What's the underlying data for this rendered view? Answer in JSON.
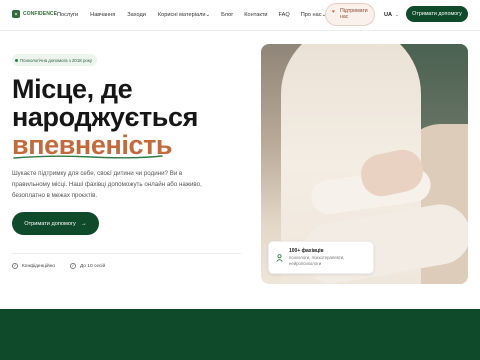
{
  "brand": {
    "logo_text": "CONFIDENCE",
    "accent": "#0f4a2b",
    "highlight": "#c16a3e"
  },
  "nav": {
    "items": [
      {
        "label": "Послуги"
      },
      {
        "label": "Навчання"
      },
      {
        "label": "Заходи"
      },
      {
        "label": "Корисні матеріали",
        "has_dropdown": true
      },
      {
        "label": "Блог"
      },
      {
        "label": "Контакти"
      },
      {
        "label": "FAQ"
      },
      {
        "label": "Про нас",
        "has_dropdown": true
      }
    ],
    "support_label_line1": "Підтримати",
    "support_label_line2": "нас",
    "support_icon": "heart-icon",
    "language": "UA",
    "cta": "Отримати допомогу"
  },
  "hero": {
    "badge": "Психологічна допомога з 2018 року",
    "title_line1": "Місце, де",
    "title_line2": "народжується",
    "title_line3": "впевненість",
    "lead": "Шукаєте підтримку для себе, своєї дитини чи родини? Ви в правильному місці. Наші фахівці допоможуть онлайн або наживо, безоплатно в межах проєктів.",
    "cta": "Отримати допомогу",
    "features": [
      {
        "icon": "check-circle-icon",
        "label": "Конфіденційно"
      },
      {
        "icon": "check-circle-icon",
        "label": "До 10 сесій"
      }
    ]
  },
  "stat_card": {
    "icon": "person-icon",
    "title": "100+ фахівців",
    "subtitle": "психологи, психотерапевти, нейропсихологи"
  }
}
